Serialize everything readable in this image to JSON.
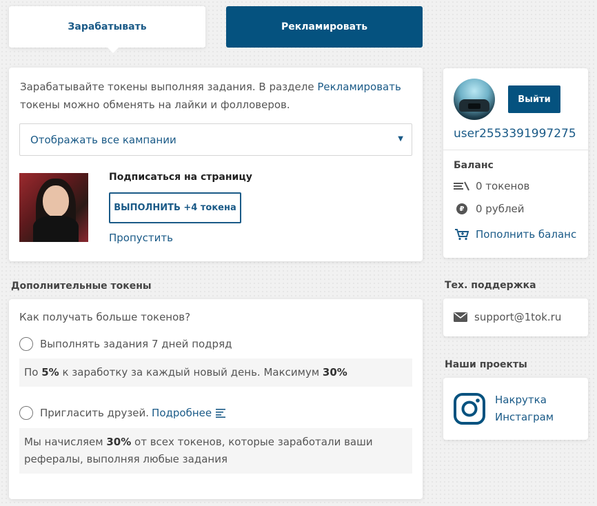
{
  "tabs": {
    "earn": "Зарабатывать",
    "advertise": "Рекламировать"
  },
  "main": {
    "intro_before": "Зарабатывайте токены выполняя задания. В разделе ",
    "intro_link": "Рекламировать",
    "intro_after": " токены можно обменять на лайки и фолловеров.",
    "campaign_select": "Отображать все кампании",
    "task_title": "Подписаться на страницу",
    "do_button": "ВЫПОЛНИТЬ +4 токена",
    "skip": "Пропустить"
  },
  "extra": {
    "section_title": "Дополнительные токены",
    "question": "Как получать больше токенов?",
    "opt1": "Выполнять задания 7 дней подряд",
    "note1_a": "По ",
    "note1_b": "5%",
    "note1_c": " к заработку за каждый новый день. Максимум ",
    "note1_d": "30%",
    "opt2": "Пригласить друзей.",
    "opt2_link": "Подробнее",
    "note2_a": "Мы начисляем ",
    "note2_b": "30%",
    "note2_c": " от всех токенов, которые заработали ваши рефералы, выполняя любые задания"
  },
  "profile": {
    "logout": "Выйти",
    "username": "user2553391997275",
    "balance_title": "Баланс",
    "tokens": "0 токенов",
    "rubles": "0 рублей",
    "topup": "Пополнить баланс"
  },
  "support": {
    "title": "Тех. поддержка",
    "email": "support@1tok.ru"
  },
  "projects": {
    "title": "Наши проекты",
    "insta_line1": "Накрутка",
    "insta_line2": "Инстаграм"
  },
  "colors": {
    "accent": "#05527f",
    "link": "#1a5a87"
  }
}
